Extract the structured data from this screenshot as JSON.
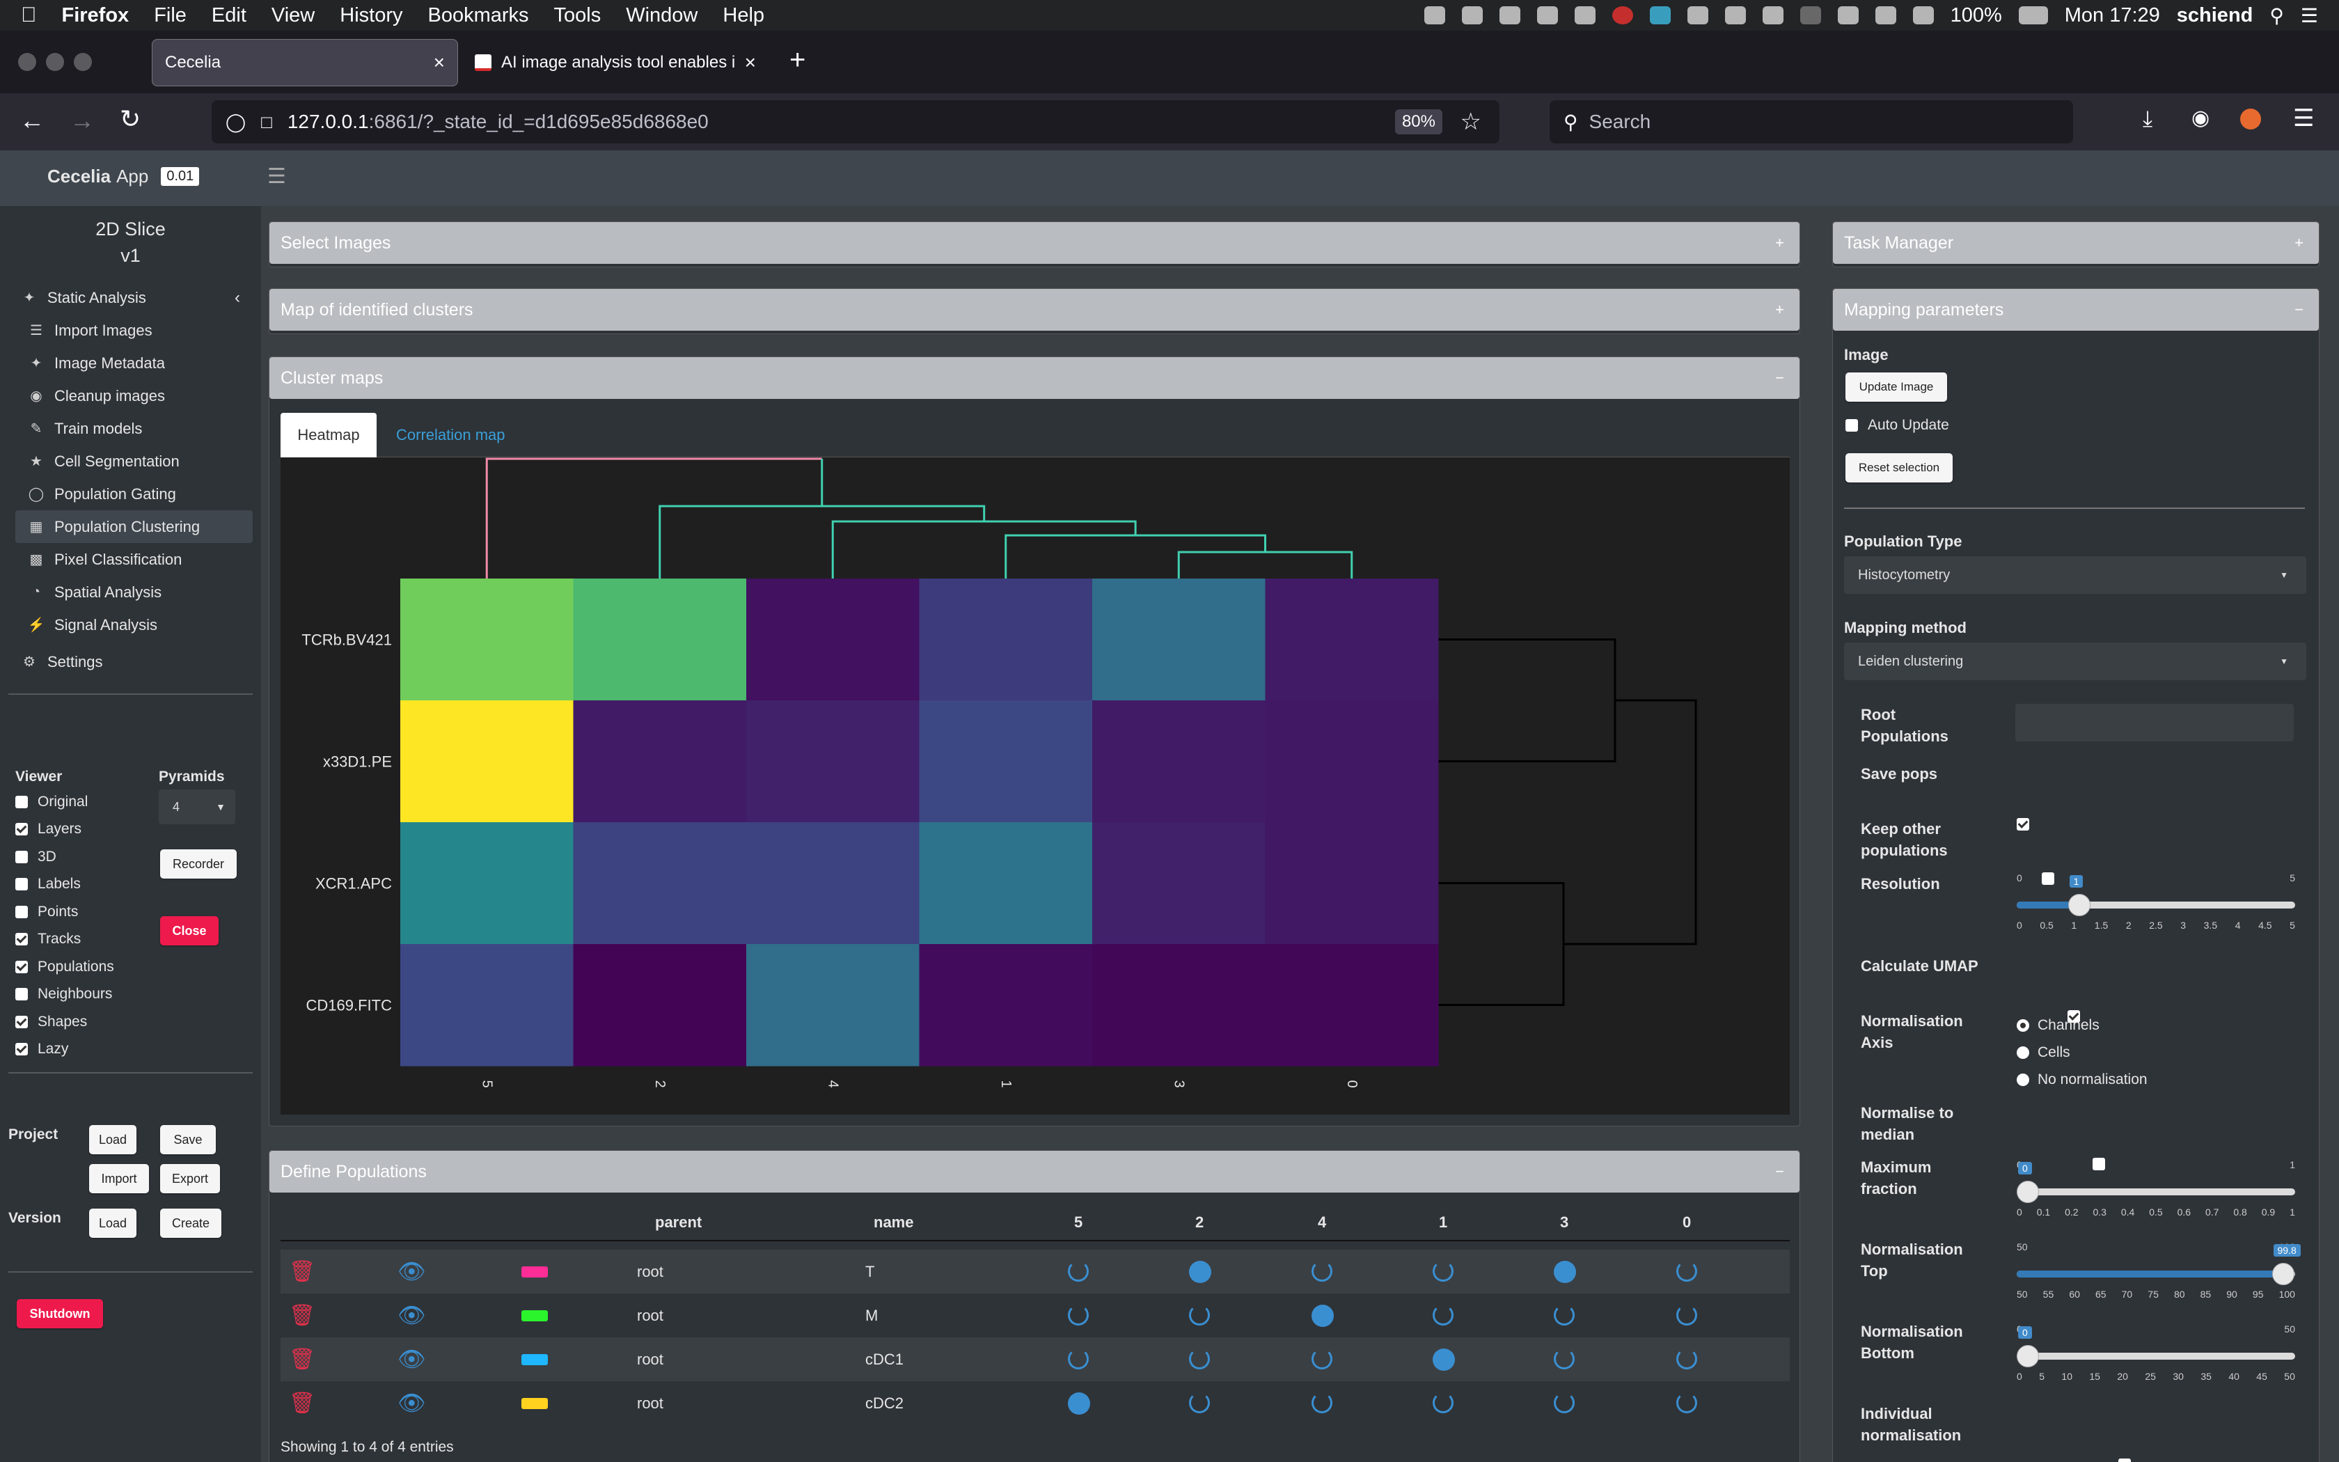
{
  "os_menubar": {
    "app": "Firefox",
    "menus": [
      "File",
      "Edit",
      "View",
      "History",
      "Bookmarks",
      "Tools",
      "Window",
      "Help"
    ],
    "battery": "100%",
    "clock": "Mon 17:29",
    "user": "schiend"
  },
  "browser": {
    "tabs": [
      {
        "title": "Cecelia",
        "active": true
      },
      {
        "title": "AI image analysis tool enables i",
        "active": false
      }
    ],
    "url_host": "127.0.0.1",
    "url_rest": ":6861/?_state_id_=d1d695e85d6868e0",
    "zoom": "80%",
    "search_placeholder": "Search"
  },
  "app": {
    "brand": "Cecelia",
    "brand_suffix": "App",
    "version": "0.01",
    "project_title": "2D Slice",
    "project_version": "v1"
  },
  "sidebar": {
    "section": "Static Analysis",
    "items": [
      {
        "label": "Import Images",
        "icon": "list-icon"
      },
      {
        "label": "Image Metadata",
        "icon": "wand-icon"
      },
      {
        "label": "Cleanup images",
        "icon": "soap-icon"
      },
      {
        "label": "Train models",
        "icon": "brush-icon"
      },
      {
        "label": "Cell Segmentation",
        "icon": "star-icon"
      },
      {
        "label": "Population Gating",
        "icon": "draw-polygon-icon"
      },
      {
        "label": "Population Clustering",
        "icon": "map-icon",
        "active": true
      },
      {
        "label": "Pixel Classification",
        "icon": "robot-icon"
      },
      {
        "label": "Spatial Analysis",
        "icon": "chart-pie-icon"
      },
      {
        "label": "Signal Analysis",
        "icon": "bolt-icon"
      }
    ],
    "settings": "Settings",
    "viewer_title": "Viewer",
    "viewer_options": [
      {
        "label": "Original",
        "checked": false
      },
      {
        "label": "Layers",
        "checked": true
      },
      {
        "label": "3D",
        "checked": false
      },
      {
        "label": "Labels",
        "checked": false
      },
      {
        "label": "Points",
        "checked": false
      },
      {
        "label": "Tracks",
        "checked": true
      },
      {
        "label": "Populations",
        "checked": true
      },
      {
        "label": "Neighbours",
        "checked": false
      },
      {
        "label": "Shapes",
        "checked": true
      },
      {
        "label": "Lazy",
        "checked": true
      }
    ],
    "pyramids_title": "Pyramids",
    "pyramids_value": "4",
    "recorder": "Recorder",
    "close": "Close",
    "project_label": "Project",
    "version_label": "Version",
    "load": "Load",
    "save": "Save",
    "import": "Import",
    "export": "Export",
    "create": "Create",
    "shutdown": "Shutdown"
  },
  "panels": {
    "select_images": "Select Images",
    "map_clusters": "Map of identified clusters",
    "cluster_maps": "Cluster maps",
    "define_populations": "Define Populations",
    "task_manager": "Task Manager",
    "mapping_parameters": "Mapping parameters"
  },
  "cluster_tabs": [
    "Heatmap",
    "Correlation map"
  ],
  "chart_data": {
    "type": "heatmap",
    "rows": [
      "TCRb.BV421",
      "x33D1.PE",
      "XCR1.APC",
      "CD169.FITC"
    ],
    "columns": [
      "5",
      "2",
      "4",
      "1",
      "3",
      "0"
    ],
    "values": [
      [
        0.78,
        0.68,
        0.05,
        0.18,
        0.36,
        0.08
      ],
      [
        1.0,
        0.08,
        0.1,
        0.22,
        0.08,
        0.07
      ],
      [
        0.46,
        0.2,
        0.2,
        0.38,
        0.1,
        0.07
      ],
      [
        0.22,
        0.01,
        0.36,
        0.03,
        0.02,
        0.02
      ]
    ],
    "colorscale": "viridis"
  },
  "mapping": {
    "image_label": "Image",
    "update_image": "Update Image",
    "auto_update": "Auto Update",
    "reset_selection": "Reset selection",
    "population_type_label": "Population Type",
    "population_type": "Histocytometry",
    "mapping_method_label": "Mapping method",
    "mapping_method": "Leiden clustering",
    "root_populations": "Root Populations",
    "save_pops": "Save pops",
    "keep_other": "Keep other populations",
    "resolution_label": "Resolution",
    "resolution": {
      "min": 0,
      "max": 5,
      "value": 1,
      "ticks": [
        "0",
        "0.5",
        "1",
        "1.5",
        "2",
        "2.5",
        "3",
        "3.5",
        "4",
        "4.5",
        "5"
      ]
    },
    "calc_umap": "Calculate UMAP",
    "norm_axis_label": "Normalisation Axis",
    "norm_axis_options": [
      "Channels",
      "Cells",
      "No normalisation"
    ],
    "normalise_median": "Normalise to median",
    "max_fraction_label": "Maximum fraction",
    "max_fraction": {
      "min": 0,
      "max": 1,
      "value": 0,
      "ticks": [
        "0",
        "0.1",
        "0.2",
        "0.3",
        "0.4",
        "0.5",
        "0.6",
        "0.7",
        "0.8",
        "0.9",
        "1"
      ]
    },
    "norm_top_label": "Normalisation Top",
    "norm_top": {
      "min": 50,
      "max": 100,
      "value": 99.8,
      "ticks": [
        "50",
        "55",
        "60",
        "65",
        "70",
        "75",
        "80",
        "85",
        "90",
        "95",
        "100"
      ]
    },
    "norm_bottom_label": "Normalisation Bottom",
    "norm_bottom": {
      "min": 0,
      "max": 50,
      "value": 0,
      "ticks": [
        "0",
        "5",
        "10",
        "15",
        "20",
        "25",
        "30",
        "35",
        "40",
        "45",
        "50"
      ]
    },
    "individual_norm": "Individual normalisation"
  },
  "populations_table": {
    "headers": [
      "parent",
      "name",
      "5",
      "2",
      "4",
      "1",
      "3",
      "0"
    ],
    "rows": [
      {
        "parent": "root",
        "name": "T",
        "color": "#ff2d95",
        "sel": [
          false,
          true,
          false,
          false,
          true,
          false
        ]
      },
      {
        "parent": "root",
        "name": "M",
        "color": "#2cf42c",
        "sel": [
          false,
          false,
          true,
          false,
          false,
          false
        ]
      },
      {
        "parent": "root",
        "name": "cDC1",
        "color": "#1fb7ff",
        "sel": [
          false,
          false,
          false,
          true,
          false,
          false
        ]
      },
      {
        "parent": "root",
        "name": "cDC2",
        "color": "#ffd21f",
        "sel": [
          true,
          false,
          false,
          false,
          false,
          false
        ]
      }
    ],
    "footer": "Showing 1 to 4 of 4 entries"
  }
}
